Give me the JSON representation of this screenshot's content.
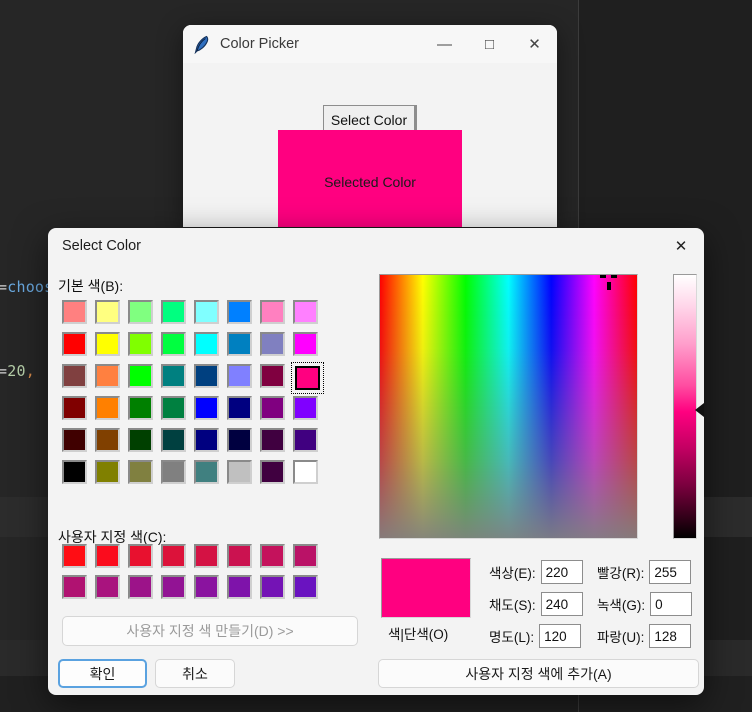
{
  "background": {
    "code_line_1_parts": [
      "=choo",
      "s"
    ],
    "code_line_1": "=choos",
    "code_line_2": "=20,"
  },
  "color_picker_window": {
    "title": "Color Picker",
    "icon": "feather-icon",
    "minimize_label": "—",
    "maximize_label": "□",
    "close_label": "✕",
    "select_color_button": "Select Color",
    "selected_color_label": "Selected Color",
    "selected_color_hex": "#FF0080"
  },
  "select_color_dialog": {
    "title": "Select Color",
    "close_label": "✕",
    "basic_colors_label": "기본 색(B):",
    "custom_colors_label": "사용자 지정 색(C):",
    "make_custom_button": "사용자 지정 색 만들기(D) >>",
    "ok_button": "확인",
    "cancel_button": "취소",
    "add_custom_button": "사용자 지정 색에 추가(A)",
    "preview_label": "색|단색(O)",
    "preview_hex": "#FF0080",
    "selected_index": 23,
    "basic_colors": [
      "#FF8080",
      "#FFFF80",
      "#80FF80",
      "#00FF80",
      "#80FFFF",
      "#0080FF",
      "#FF80C0",
      "#FF80FF",
      "#FF0000",
      "#FFFF00",
      "#80FF00",
      "#00FF40",
      "#00FFFF",
      "#0080C0",
      "#8080C0",
      "#FF00FF",
      "#804040",
      "#FF8040",
      "#00FF00",
      "#008080",
      "#004080",
      "#8080FF",
      "#800040",
      "#FF0080",
      "#800000",
      "#FF8000",
      "#008000",
      "#008040",
      "#0000FF",
      "#000080",
      "#800080",
      "#8000FF",
      "#400000",
      "#804000",
      "#004000",
      "#004040",
      "#000080",
      "#000040",
      "#400040",
      "#400080",
      "#000000",
      "#808000",
      "#808040",
      "#808080",
      "#408080",
      "#C0C0C0",
      "#400040",
      "#FFFFFF"
    ],
    "custom_colors": [
      "#FF0D14",
      "#FB0C1D",
      "#E8112F",
      "#DC123A",
      "#D41244",
      "#CB1250",
      "#C4125C",
      "#BA1267",
      "#B01271",
      "#A9137E",
      "#9C1389",
      "#921394",
      "#8A139F",
      "#7E13AA",
      "#7413B5",
      "#6A13C0"
    ],
    "fields": [
      {
        "id": "hue",
        "label": "색상(E):",
        "value": "220"
      },
      {
        "id": "saturation",
        "label": "채도(S):",
        "value": "240"
      },
      {
        "id": "luminance",
        "label": "명도(L):",
        "value": "120"
      },
      {
        "id": "red",
        "label": "빨강(R):",
        "value": "255"
      },
      {
        "id": "green",
        "label": "녹색(G):",
        "value": "0"
      },
      {
        "id": "blue",
        "label": "파랑(U):",
        "value": "128"
      }
    ]
  }
}
